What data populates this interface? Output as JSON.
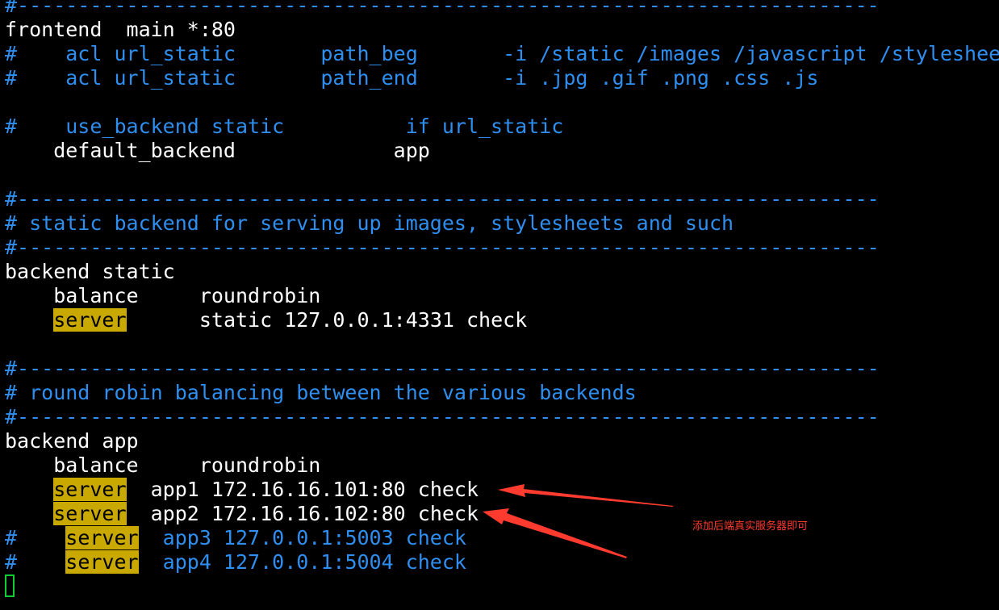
{
  "terminal": {
    "lines": [
      {
        "name": "separator-top",
        "segments": [
          {
            "t": "#-----------------------------------------------------------------------",
            "s": "c"
          }
        ]
      },
      {
        "name": "frontend-line",
        "segments": [
          {
            "t": "frontend  main *:80",
            "s": "w"
          }
        ]
      },
      {
        "name": "acl-path-beg-line",
        "segments": [
          {
            "t": "#    acl url_static       path_beg       -i /static /images /javascript /stylesheets",
            "s": "c"
          }
        ]
      },
      {
        "name": "acl-path-end-line",
        "segments": [
          {
            "t": "#    acl url_static       path_end       -i .jpg .gif .png .css .js",
            "s": "c"
          }
        ]
      },
      {
        "name": "blank-line-1",
        "segments": []
      },
      {
        "name": "use-backend-line",
        "segments": [
          {
            "t": "#    use_backend static          if url_static",
            "s": "c"
          }
        ]
      },
      {
        "name": "default-backend-line",
        "segments": [
          {
            "t": "    default_backend             app",
            "s": "w"
          }
        ]
      },
      {
        "name": "blank-line-2",
        "segments": []
      },
      {
        "name": "separator-static-top",
        "segments": [
          {
            "t": "#-----------------------------------------------------------------------",
            "s": "c"
          }
        ]
      },
      {
        "name": "static-comment-line",
        "segments": [
          {
            "t": "# static backend for serving up images, stylesheets and such",
            "s": "c"
          }
        ]
      },
      {
        "name": "separator-static-bottom",
        "segments": [
          {
            "t": "#-----------------------------------------------------------------------",
            "s": "c"
          }
        ]
      },
      {
        "name": "backend-static-line",
        "segments": [
          {
            "t": "backend static",
            "s": "w"
          }
        ]
      },
      {
        "name": "balance-static-line",
        "segments": [
          {
            "t": "    balance     roundrobin",
            "s": "w"
          }
        ]
      },
      {
        "name": "server-static-line",
        "segments": [
          {
            "t": "    ",
            "s": "w"
          },
          {
            "t": "server",
            "s": "hl"
          },
          {
            "t": "      static 127.0.0.1:4331 check",
            "s": "w"
          }
        ]
      },
      {
        "name": "blank-line-3",
        "segments": []
      },
      {
        "name": "separator-app-top",
        "segments": [
          {
            "t": "#-----------------------------------------------------------------------",
            "s": "c"
          }
        ]
      },
      {
        "name": "app-comment-line",
        "segments": [
          {
            "t": "# round robin balancing between the various backends",
            "s": "c"
          }
        ]
      },
      {
        "name": "separator-app-bottom",
        "segments": [
          {
            "t": "#-----------------------------------------------------------------------",
            "s": "c"
          }
        ]
      },
      {
        "name": "backend-app-line",
        "segments": [
          {
            "t": "backend app",
            "s": "w"
          }
        ]
      },
      {
        "name": "balance-app-line",
        "segments": [
          {
            "t": "    balance     roundrobin",
            "s": "w"
          }
        ]
      },
      {
        "name": "server-app1-line",
        "segments": [
          {
            "t": "    ",
            "s": "w"
          },
          {
            "t": "server",
            "s": "hl"
          },
          {
            "t": "  app1 172.16.16.101:80 check",
            "s": "w"
          }
        ]
      },
      {
        "name": "server-app2-line",
        "segments": [
          {
            "t": "    ",
            "s": "w"
          },
          {
            "t": "server",
            "s": "hl"
          },
          {
            "t": "  app2 172.16.16.102:80 check",
            "s": "w"
          }
        ]
      },
      {
        "name": "server-app3-line",
        "segments": [
          {
            "t": "#    ",
            "s": "c"
          },
          {
            "t": "server",
            "s": "hl"
          },
          {
            "t": "  app3 127.0.0.1:5003 check",
            "s": "c"
          }
        ]
      },
      {
        "name": "server-app4-line",
        "segments": [
          {
            "t": "#    ",
            "s": "c"
          },
          {
            "t": "server",
            "s": "hl"
          },
          {
            "t": "  app4 127.0.0.1:5004 check",
            "s": "c"
          }
        ]
      }
    ]
  },
  "annotation": {
    "note": "添加后端真实服务器即可",
    "color": "#ff3b30"
  },
  "colors": {
    "background": "#000000",
    "text": "#ffffff",
    "comment": "#2f8ff0",
    "highlight": "#c9a800",
    "cursor": "#11cc33"
  }
}
